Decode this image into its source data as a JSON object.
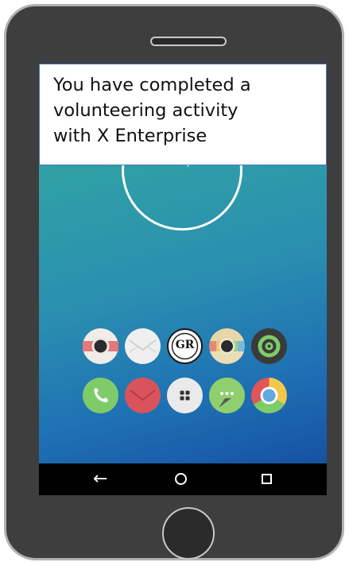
{
  "notification": {
    "line1": "You have completed a",
    "line2": "volunteering activity",
    "line3": "with X Enterprise"
  },
  "app_logo": {
    "text": "GR"
  },
  "home_icons": {
    "row1": [
      "camera-icon",
      "mail-icon",
      "gr-logo-icon",
      "gallery-icon",
      "music-icon"
    ],
    "row2": [
      "phone-icon",
      "email-icon",
      "apps-icon",
      "messages-icon",
      "chrome-icon"
    ]
  },
  "navbar": {
    "back_symbol": "←"
  }
}
